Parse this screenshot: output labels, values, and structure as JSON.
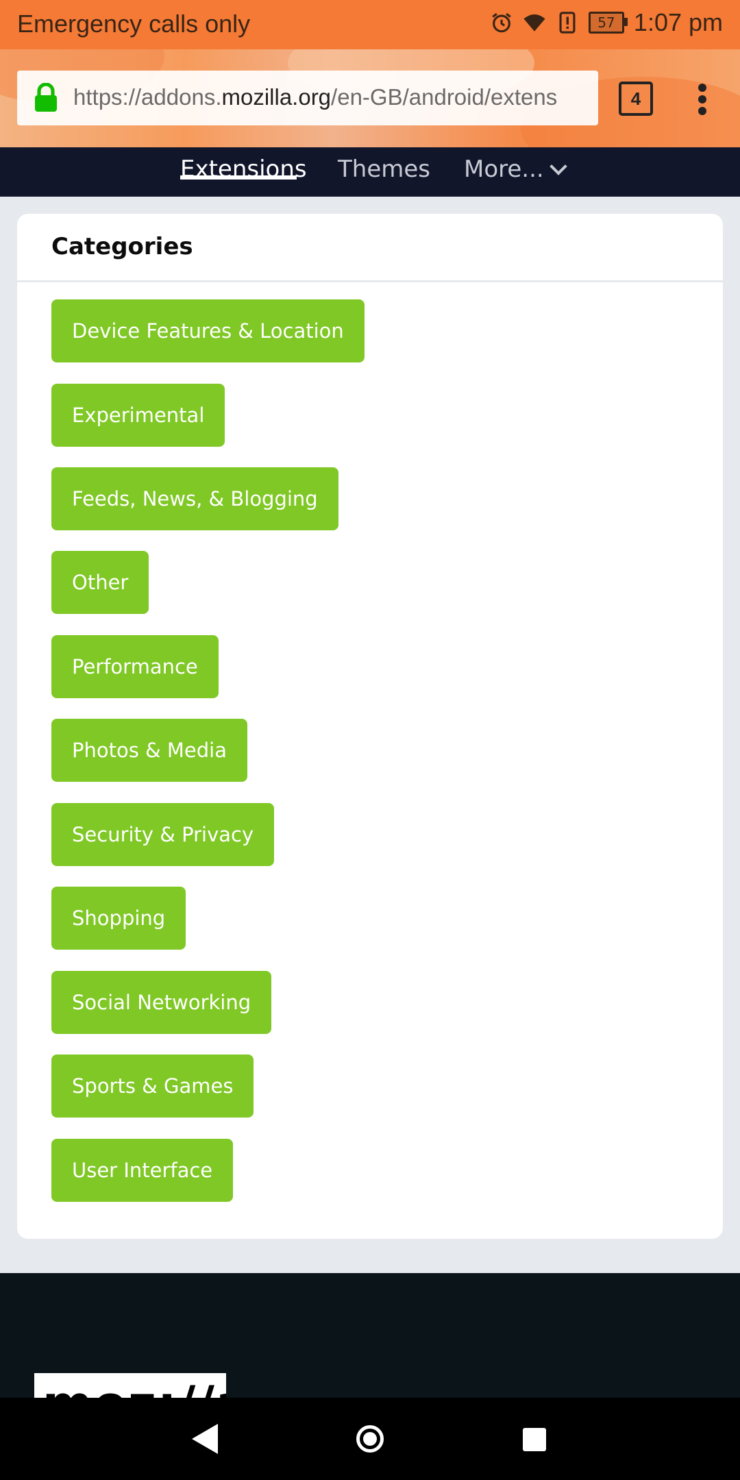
{
  "status_bar": {
    "left_text": "Emergency calls only",
    "battery_level": "57",
    "time": "1:07 pm"
  },
  "browser": {
    "url_prefix": "https://addons.",
    "url_host": "mozilla.org",
    "url_path": "/en-GB/android/extens",
    "tab_count": "4"
  },
  "site_nav": {
    "tabs": [
      {
        "label": "Extensions",
        "active": true
      },
      {
        "label": "Themes",
        "active": false
      },
      {
        "label": "More..."
      }
    ]
  },
  "categories": {
    "title": "Categories",
    "items": [
      {
        "label": "Device Features & Location"
      },
      {
        "label": "Experimental"
      },
      {
        "label": "Feeds, News, & Blogging"
      },
      {
        "label": "Other"
      },
      {
        "label": "Performance"
      },
      {
        "label": "Photos & Media"
      },
      {
        "label": "Security & Privacy"
      },
      {
        "label": "Shopping"
      },
      {
        "label": "Social Networking"
      },
      {
        "label": "Sports & Games"
      },
      {
        "label": "User Interface"
      }
    ]
  },
  "footer": {
    "logo_text": "moz://a"
  },
  "colors": {
    "status_bar": "#f47a35",
    "nav_bg": "#12162b",
    "category_green": "#7fc825",
    "footer_bg": "#0b1418"
  }
}
